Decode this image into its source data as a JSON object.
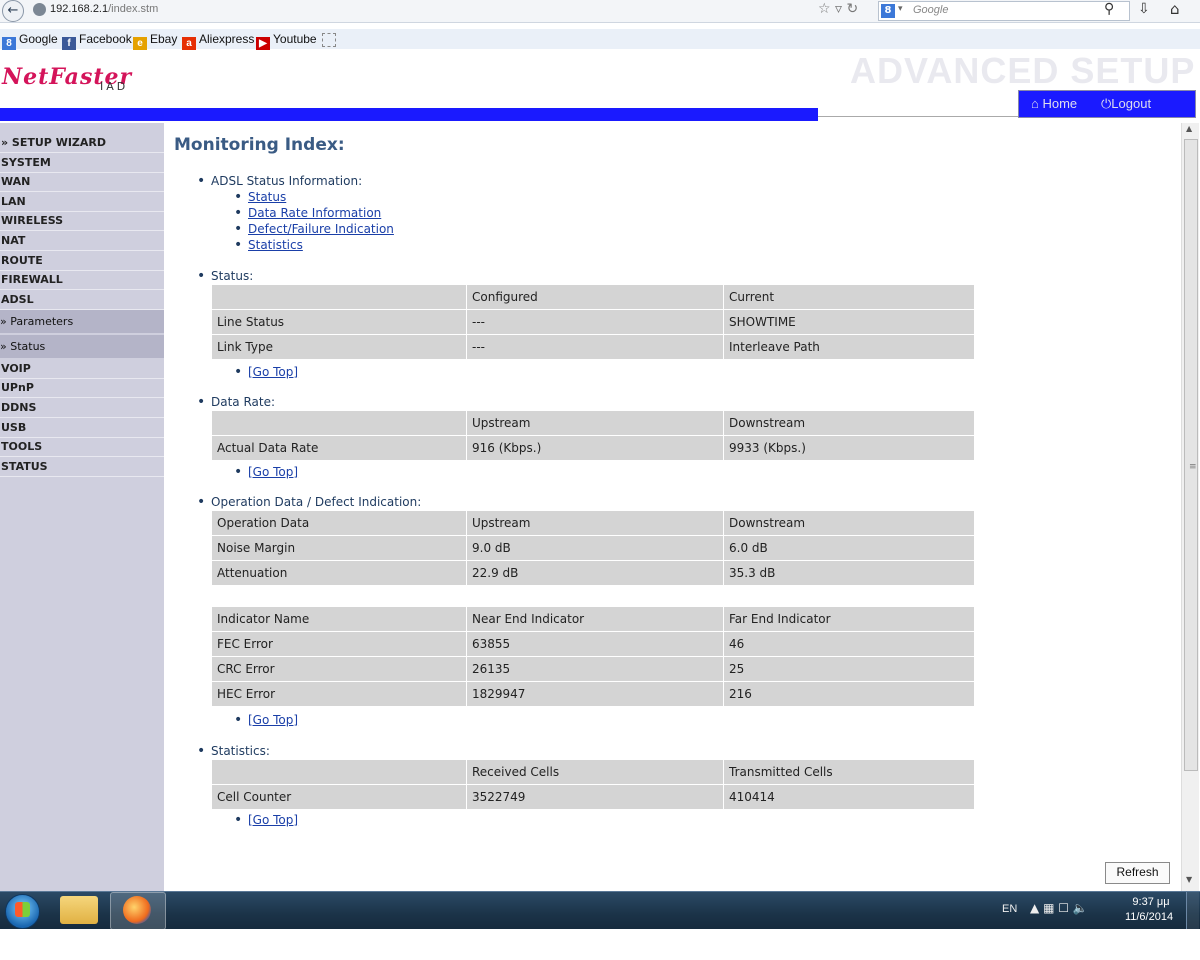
{
  "browser": {
    "url_host": "192.168.2.1",
    "url_path": "/index.stm",
    "search_placeholder": "Google",
    "search_engine": "g-icon",
    "bookmarks": [
      {
        "label": "Google",
        "icon": "google-icon",
        "color": "#3c78d8"
      },
      {
        "label": "Facebook",
        "icon": "facebook-icon",
        "color": "#3b5998"
      },
      {
        "label": "Ebay",
        "icon": "ebay-icon",
        "color": "#e53238"
      },
      {
        "label": "Aliexpress",
        "icon": "aliexpress-icon",
        "color": "#e62e04"
      },
      {
        "label": "Youtube",
        "icon": "youtube-icon",
        "color": "#cc0000"
      }
    ]
  },
  "header": {
    "logo": "NetFaster",
    "logo_sub": "IAD",
    "banner": "ADVANCED SETUP",
    "home": "Home",
    "logout": "Logout"
  },
  "sidebar": {
    "items": [
      "» SETUP WIZARD",
      "SYSTEM",
      "WAN",
      "LAN",
      "WIRELESS",
      "NAT",
      "ROUTE",
      "FIREWALL",
      "ADSL",
      "» Parameters",
      "» Status",
      "VOIP",
      "UPnP",
      "DDNS",
      "USB",
      "TOOLS",
      "STATUS"
    ]
  },
  "main": {
    "title": "Monitoring Index:",
    "index_heading": "ADSL Status Information:",
    "index_links": [
      "Status",
      "Data Rate Information",
      "Defect/Failure Indication",
      "Statistics"
    ],
    "go_top": "[Go Top]",
    "status": {
      "heading": "Status:",
      "header": [
        "",
        "Configured",
        "Current"
      ],
      "rows": [
        [
          "Line Status",
          "---",
          "SHOWTIME"
        ],
        [
          "Link Type",
          "---",
          "Interleave Path"
        ]
      ]
    },
    "data_rate": {
      "heading": "Data Rate:",
      "header": [
        "",
        "Upstream",
        "Downstream"
      ],
      "rows": [
        [
          "Actual Data Rate",
          "916 (Kbps.)",
          "9933 (Kbps.)"
        ]
      ]
    },
    "operation": {
      "heading": "Operation Data / Defect Indication:",
      "header": [
        "Operation Data",
        "Upstream",
        "Downstream"
      ],
      "rows": [
        [
          "Noise Margin",
          "9.0 dB",
          "6.0 dB"
        ],
        [
          "Attenuation",
          "22.9 dB",
          "35.3 dB"
        ]
      ]
    },
    "indicators": {
      "header": [
        "Indicator Name",
        "Near End Indicator",
        "Far End Indicator"
      ],
      "rows": [
        [
          "FEC Error",
          "63855",
          "46"
        ],
        [
          "CRC Error",
          "26135",
          "25"
        ],
        [
          "HEC Error",
          "1829947",
          "216"
        ]
      ]
    },
    "statistics": {
      "heading": "Statistics:",
      "header": [
        "",
        "Received Cells",
        "Transmitted Cells"
      ],
      "rows": [
        [
          "Cell Counter",
          "3522749",
          "410414"
        ]
      ]
    },
    "refresh": "Refresh"
  },
  "taskbar": {
    "lang": "EN",
    "time": "9:37 μμ",
    "date": "11/6/2014"
  },
  "colors": {
    "accent_blue": "#1a1aff",
    "logo_red": "#d4145a",
    "title_blue": "#3a5b84",
    "sidebar_bg": "#cfcfde",
    "table_cell": "#d4d4d4"
  }
}
